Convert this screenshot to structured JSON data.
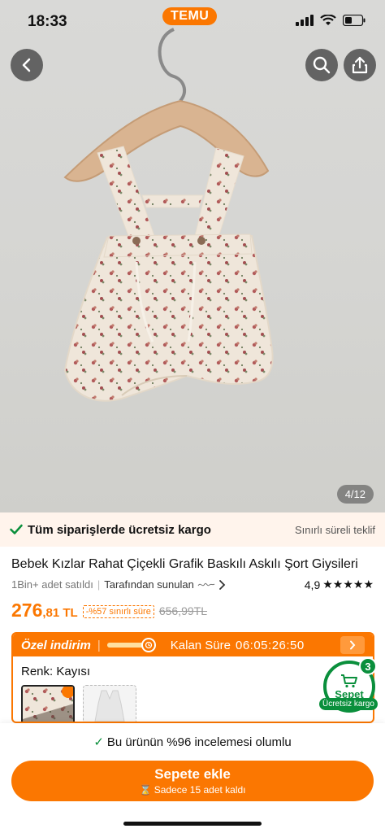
{
  "status_bar": {
    "time": "18:33"
  },
  "brand": {
    "name": "TEMU",
    "color": "#fb7701"
  },
  "hero": {
    "icons": {
      "back": "chevron-left-icon",
      "search": "search-icon",
      "share": "share-icon"
    },
    "image_counter": "4/12"
  },
  "shipping_banner": {
    "text": "Tüm siparişlerde ücretsiz kargo",
    "right_text": "Sınırlı süreli teklif"
  },
  "product": {
    "title": "Bebek Kızlar Rahat Çiçekli Grafik Baskılı Askılı Şort Giysileri",
    "sold": "1Bin+ adet satıldı",
    "seller": "Tarafından sunulan",
    "rating": "4,9",
    "stars": 5,
    "price_int": "276",
    "price_dec": ",81 TL",
    "discount": "-%57 sınırlı süre",
    "old_price": "656,99TL"
  },
  "deal": {
    "title": "Özel indirim",
    "remaining_label": "Kalan Süre",
    "countdown": "06:05:26:50",
    "progress": 0.85,
    "color_label": "Renk: Kayısı"
  },
  "cart": {
    "label": "Sepet",
    "count": "3",
    "shipping": "Ücretsiz kargo",
    "accent": "#0a8f3c"
  },
  "bottom": {
    "review_note": "Bu ürünün %96 incelemesi olumlu",
    "add_to_cart": "Sepete ekle",
    "stock_note": "Sadece 15 adet kaldı"
  }
}
